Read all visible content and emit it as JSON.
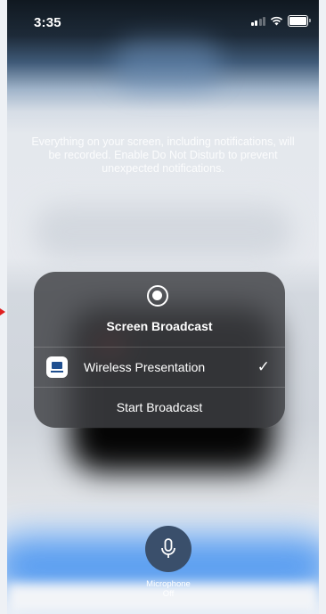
{
  "status_bar": {
    "time": "3:35",
    "signal_icon": "signal-icon",
    "wifi_icon": "wifi-icon",
    "battery_icon": "battery-icon"
  },
  "notice_text": "Everything on your screen, including notifications, will be recorded. Enable Do Not Disturb to prevent unexpected notifications.",
  "broadcast_sheet": {
    "icon": "record-icon",
    "title": "Screen Broadcast",
    "selected_app": {
      "label": "Wireless Presentation",
      "icon": "app-icon",
      "checked": true
    },
    "start_label": "Start Broadcast"
  },
  "microphone": {
    "label": "Microphone",
    "state": "Off",
    "icon": "microphone-icon"
  },
  "colors": {
    "sheet_bg": "#3e4043",
    "mic_button": "#3a4f6b",
    "bottom_blur": "#3d8ef0",
    "edge_arrow": "#e02020"
  }
}
